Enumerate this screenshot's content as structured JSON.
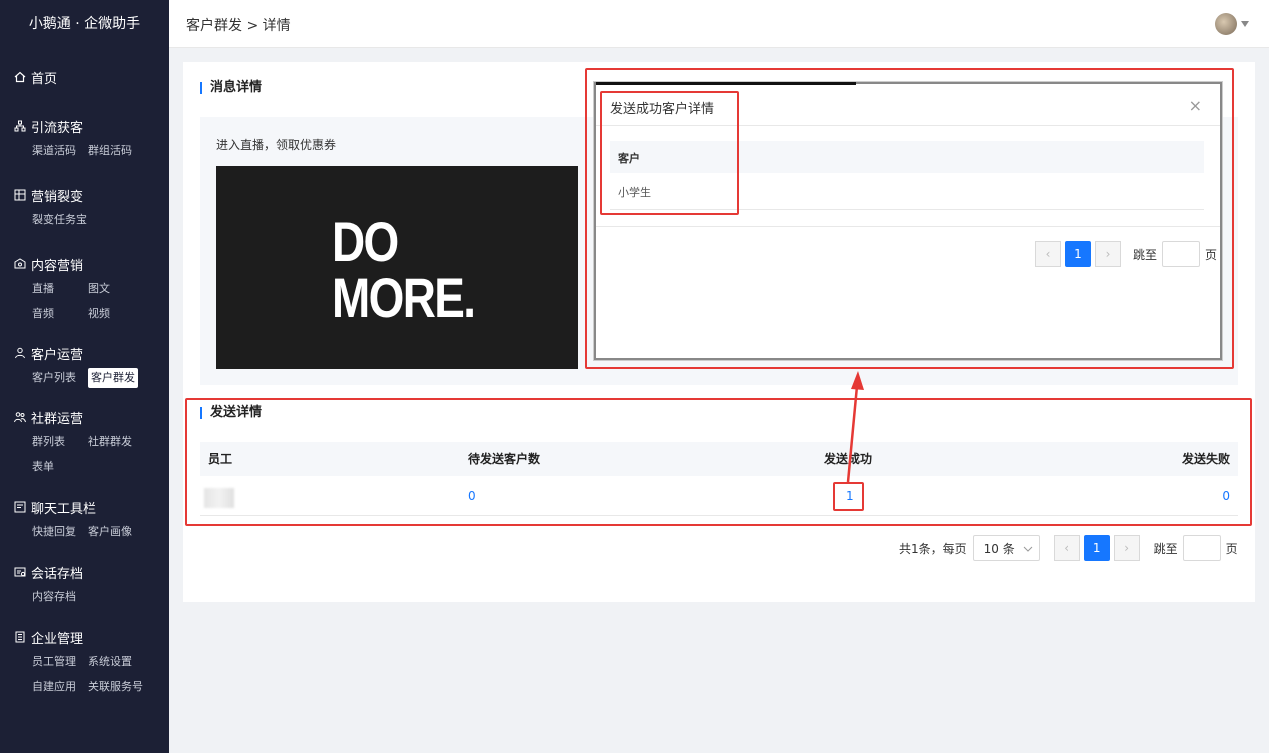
{
  "sidebar": {
    "brand": "小鹅通 · 企微助手",
    "groups": [
      {
        "title": "首页",
        "icon": "home-icon",
        "items": []
      },
      {
        "title": "引流获客",
        "icon": "sitemap-icon",
        "items": [
          "渠道活码",
          "群组活码"
        ]
      },
      {
        "title": "营销裂变",
        "icon": "grid-icon",
        "items": [
          "裂变任务宝"
        ]
      },
      {
        "title": "内容营销",
        "icon": "content-icon",
        "items": [
          "直播",
          "图文",
          "音频",
          "视频"
        ]
      },
      {
        "title": "客户运营",
        "icon": "user-icon",
        "items": [
          "客户列表",
          "客户群发"
        ]
      },
      {
        "title": "社群运营",
        "icon": "users-icon",
        "items": [
          "群列表",
          "社群群发",
          "表单"
        ]
      },
      {
        "title": "聊天工具栏",
        "icon": "chat-tool-icon",
        "items": [
          "快捷回复",
          "客户画像"
        ]
      },
      {
        "title": "会话存档",
        "icon": "archive-icon",
        "items": [
          "内容存档"
        ]
      },
      {
        "title": "企业管理",
        "icon": "company-icon",
        "items": [
          "员工管理",
          "系统设置",
          "自建应用",
          "关联服务号"
        ]
      }
    ],
    "active_item": "客户群发"
  },
  "header": {
    "breadcrumb": "客户群发 > 详情"
  },
  "message": {
    "section_title": "消息详情",
    "text": "进入直播，领取优惠券",
    "poster_line1": "DO",
    "poster_line2": "MORE."
  },
  "send": {
    "section_title": "发送详情",
    "columns": [
      "员工",
      "待发送客户数",
      "发送成功",
      "发送失败"
    ],
    "rows": [
      {
        "pending": "0",
        "success": "1",
        "failed": "0"
      }
    ]
  },
  "pagination": {
    "total_text": "共1条，每页",
    "page_size": "10 条",
    "current_page": "1",
    "jump_label": "跳至",
    "page_unit": "页"
  },
  "modal": {
    "title": "发送成功客户详情",
    "close": "×",
    "column": "客户",
    "rows": [
      "小学生"
    ],
    "current_page": "1",
    "jump_label": "跳至",
    "page_unit": "页"
  },
  "colors": {
    "sidebar_bg": "#1c2035",
    "primary": "#1677ff",
    "annotation": "#e53935"
  }
}
